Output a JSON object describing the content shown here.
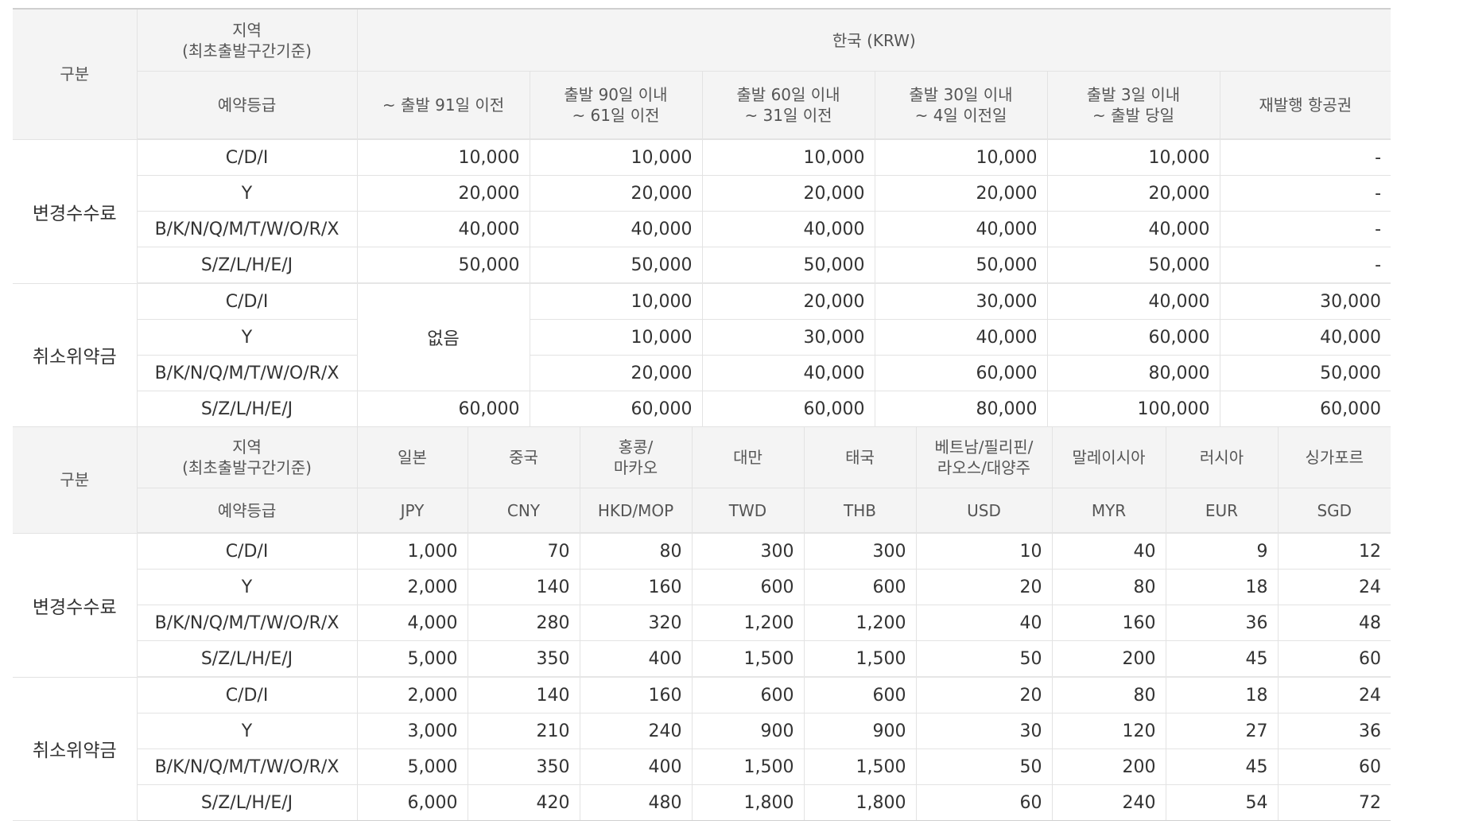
{
  "common": {
    "category": "구분",
    "region": "지역\n(최초출발구간기준)",
    "grade": "예약등급",
    "change_fee": "변경수수료",
    "cancel_fee": "취소위약금"
  },
  "table1": {
    "currency_header": "한국 (KRW)",
    "periods": [
      "~ 출발 91일 이전",
      "출발 90일 이내\n~ 61일 이전",
      "출발 60일 이내\n~ 31일 이전",
      "출발 30일 이내\n~ 4일 이전일",
      "출발 3일 이내\n~ 출발 당일",
      "재발행 항공권"
    ],
    "none_label": "없음",
    "change_rows": [
      {
        "cls": "C/D/I",
        "values": [
          "10,000",
          "10,000",
          "10,000",
          "10,000",
          "10,000",
          "-"
        ]
      },
      {
        "cls": "Y",
        "values": [
          "20,000",
          "20,000",
          "20,000",
          "20,000",
          "20,000",
          "-"
        ]
      },
      {
        "cls": "B/K/N/Q/M/T/W/O/R/X",
        "values": [
          "40,000",
          "40,000",
          "40,000",
          "40,000",
          "40,000",
          "-"
        ]
      },
      {
        "cls": "S/Z/L/H/E/J",
        "values": [
          "50,000",
          "50,000",
          "50,000",
          "50,000",
          "50,000",
          "-"
        ]
      }
    ],
    "cancel_rows": [
      {
        "cls": "C/D/I",
        "values": [
          "10,000",
          "20,000",
          "30,000",
          "40,000",
          "30,000"
        ]
      },
      {
        "cls": "Y",
        "values": [
          "10,000",
          "30,000",
          "40,000",
          "60,000",
          "40,000"
        ]
      },
      {
        "cls": "B/K/N/Q/M/T/W/O/R/X",
        "values": [
          "20,000",
          "40,000",
          "60,000",
          "80,000",
          "50,000"
        ]
      },
      {
        "cls": "S/Z/L/H/E/J",
        "values": [
          "60,000",
          "60,000",
          "60,000",
          "80,000",
          "100,000",
          "60,000"
        ]
      }
    ]
  },
  "table2": {
    "regions": [
      "일본",
      "중국",
      "홍콩/\n마카오",
      "대만",
      "태국",
      "베트남/필리핀/\n라오스/대양주",
      "말레이시아",
      "러시아",
      "싱가포르"
    ],
    "currencies": [
      "JPY",
      "CNY",
      "HKD/MOP",
      "TWD",
      "THB",
      "USD",
      "MYR",
      "EUR",
      "SGD"
    ],
    "change_rows": [
      {
        "cls": "C/D/I",
        "values": [
          "1,000",
          "70",
          "80",
          "300",
          "300",
          "10",
          "40",
          "9",
          "12"
        ]
      },
      {
        "cls": "Y",
        "values": [
          "2,000",
          "140",
          "160",
          "600",
          "600",
          "20",
          "80",
          "18",
          "24"
        ]
      },
      {
        "cls": "B/K/N/Q/M/T/W/O/R/X",
        "values": [
          "4,000",
          "280",
          "320",
          "1,200",
          "1,200",
          "40",
          "160",
          "36",
          "48"
        ]
      },
      {
        "cls": "S/Z/L/H/E/J",
        "values": [
          "5,000",
          "350",
          "400",
          "1,500",
          "1,500",
          "50",
          "200",
          "45",
          "60"
        ]
      }
    ],
    "cancel_rows": [
      {
        "cls": "C/D/I",
        "values": [
          "2,000",
          "140",
          "160",
          "600",
          "600",
          "20",
          "80",
          "18",
          "24"
        ]
      },
      {
        "cls": "Y",
        "values": [
          "3,000",
          "210",
          "240",
          "900",
          "900",
          "30",
          "120",
          "27",
          "36"
        ]
      },
      {
        "cls": "B/K/N/Q/M/T/W/O/R/X",
        "values": [
          "5,000",
          "350",
          "400",
          "1,500",
          "1,500",
          "50",
          "200",
          "45",
          "60"
        ]
      },
      {
        "cls": "S/Z/L/H/E/J",
        "values": [
          "6,000",
          "420",
          "480",
          "1,800",
          "1,800",
          "60",
          "240",
          "54",
          "72"
        ]
      }
    ]
  }
}
